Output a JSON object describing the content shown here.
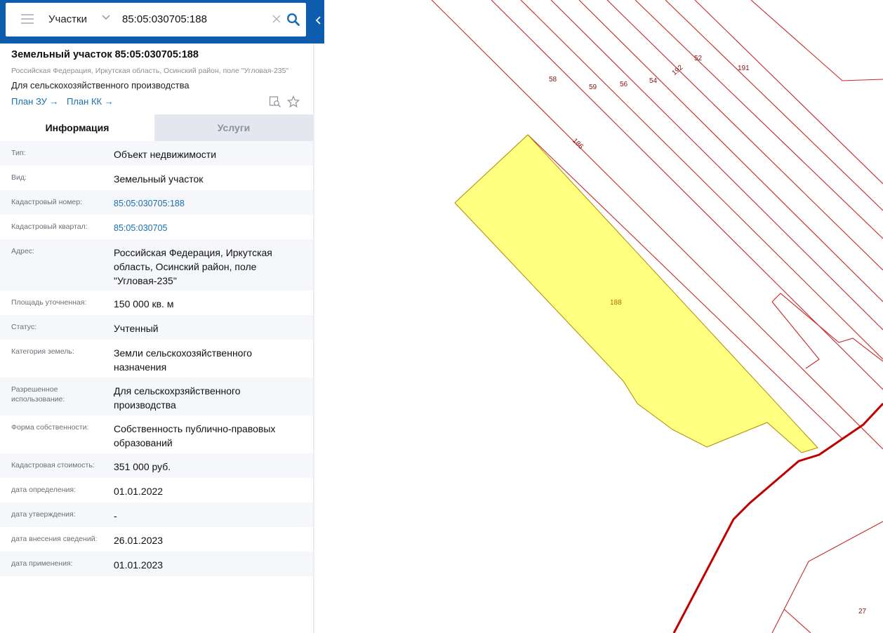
{
  "search": {
    "category": "Участки",
    "query": "85:05:030705:188"
  },
  "parcel": {
    "title": "Земельный участок 85:05:030705:188",
    "address": "Российская Федерация, Иркутская область, Осинский район, поле \"Угловая-235\"",
    "usage": "Для сельскохозяйственного производства",
    "plan_zu": "План ЗУ →",
    "plan_kk": "План КК →"
  },
  "tabs": {
    "info": "Информация",
    "services": "Услуги"
  },
  "details": [
    {
      "label": "Тип:",
      "value": "Объект недвижимости"
    },
    {
      "label": "Вид:",
      "value": "Земельный участок"
    },
    {
      "label": "Кадастровый номер:",
      "value": "85:05:030705:188"
    },
    {
      "label": "Кадастровый квартал:",
      "value": "85:05:030705"
    },
    {
      "label": "Адрес:",
      "value": "Российская Федерация, Иркутская область, Осинский район, поле \"Угловая-235\""
    },
    {
      "label": "Площадь уточненная:",
      "value": "150 000 кв. м"
    },
    {
      "label": "Статус:",
      "value": "Учтенный"
    },
    {
      "label": "Категория земель:",
      "value": "Земли сельскохозяйственного назначения"
    },
    {
      "label": "Разрешенное использование:",
      "value": "Для сельскохрзяйственного производства"
    },
    {
      "label": "Форма собственности:",
      "value": "Собственность публично-правовых образований"
    },
    {
      "label": "Кадастровая стоимость:",
      "value": "351 000 руб."
    },
    {
      "label": "дата определения:",
      "value": "01.01.2022"
    },
    {
      "label": "дата утверждения:",
      "value": "-"
    },
    {
      "label": "дата внесения сведений:",
      "value": "26.01.2023"
    },
    {
      "label": "дата применения:",
      "value": "01.01.2023"
    }
  ],
  "map_labels": {
    "p58": "58",
    "p59": "59",
    "p56": "56",
    "p54": "54",
    "p192": "192",
    "p52": "52",
    "p191": "191",
    "p186": "186",
    "p188": "188",
    "p27": "27"
  },
  "colors": {
    "header_blue": "#0d5cad",
    "link_blue": "#1a6fb3",
    "parcel_fill": "#ffff80",
    "boundary_red": "#c00000"
  }
}
